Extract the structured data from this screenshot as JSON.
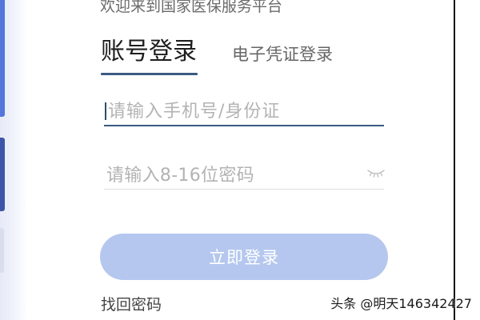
{
  "header": {
    "welcome": "欢迎来到国家医保服务平台"
  },
  "tabs": [
    {
      "label": "账号登录",
      "active": true
    },
    {
      "label": "电子凭证登录",
      "active": false
    }
  ],
  "form": {
    "account": {
      "placeholder": "请输入手机号/身份证",
      "value": "",
      "focused": true
    },
    "password": {
      "placeholder": "请输入8-16位密码",
      "value": "",
      "toggle_icon": "eye-closed-icon"
    },
    "submit_label": "立即登录",
    "forgot_label": "找回密码"
  },
  "watermark": "头条 @明天146342427",
  "colors": {
    "accent": "#3c5a82",
    "button_bg": "#b5c7ee",
    "button_text": "#ffffff",
    "placeholder": "#b3b3b3",
    "side_blue": "#5574dc"
  }
}
